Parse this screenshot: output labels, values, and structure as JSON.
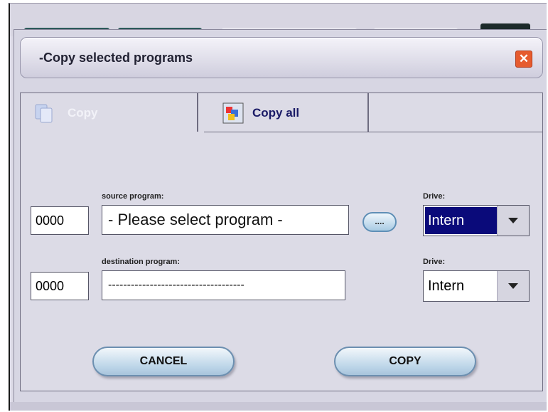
{
  "dialog": {
    "title": "-Copy selected programs",
    "close_icon": "close-icon"
  },
  "tabs": [
    {
      "label": "Copy",
      "icon": "copy-icon",
      "active": true
    },
    {
      "label": "Copy all",
      "icon": "copy-all-icon",
      "active": false
    }
  ],
  "source": {
    "number": "0000",
    "caption": "source program:",
    "value": "- Please select program -",
    "browse_label": "....",
    "drive_caption": "Drive:",
    "drive_value": "Intern"
  },
  "destination": {
    "number": "0000",
    "caption": "destination program:",
    "value": "------------------------------------",
    "drive_caption": "Drive:",
    "drive_value": "Intern"
  },
  "buttons": {
    "cancel": "CANCEL",
    "copy": "COPY"
  },
  "colors": {
    "close_button": "#e65b2e",
    "selected_drive_bg": "#0a0a7a",
    "pill_button": "#bcd5e8"
  }
}
